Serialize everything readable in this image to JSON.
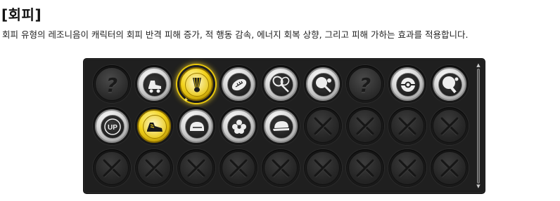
{
  "header": {
    "title": "[회피]",
    "description": "회피 유형의 레조니음이 캐릭터의 회피 반격 피해 증가, 적 행동 감속, 에너지 회복 상향, 그리고 피해 가하는 효과를 적용합니다."
  },
  "locked_glyph": "?",
  "up_badge": "UP",
  "rows": [
    [
      {
        "state": "locked",
        "icon": "question-mark-icon"
      },
      {
        "state": "silver",
        "icon": "roller-skate-icon"
      },
      {
        "state": "gold",
        "icon": "shuttlecock-icon",
        "selected": true
      },
      {
        "state": "silver",
        "icon": "american-football-icon"
      },
      {
        "state": "silver",
        "icon": "badminton-racket-icon"
      },
      {
        "state": "silver",
        "icon": "table-tennis-racket-icon"
      },
      {
        "state": "locked",
        "icon": "question-mark-icon"
      },
      {
        "state": "silver",
        "icon": "pokeball-icon"
      },
      {
        "state": "silver",
        "icon": "ping-pong-paddle-icon"
      }
    ],
    [
      {
        "state": "silver",
        "icon": "up-badge-icon"
      },
      {
        "state": "gold",
        "icon": "sneaker-icon"
      },
      {
        "state": "silver",
        "icon": "helmet-icon"
      },
      {
        "state": "silver",
        "icon": "flower-icon"
      },
      {
        "state": "silver",
        "icon": "cap-icon"
      },
      {
        "state": "empty",
        "icon": "empty-slot-x-icon"
      },
      {
        "state": "empty",
        "icon": "empty-slot-x-icon"
      },
      {
        "state": "empty",
        "icon": "empty-slot-x-icon"
      },
      {
        "state": "empty",
        "icon": "empty-slot-x-icon"
      }
    ],
    [
      {
        "state": "empty",
        "icon": "empty-slot-x-icon"
      },
      {
        "state": "empty",
        "icon": "empty-slot-x-icon"
      },
      {
        "state": "empty",
        "icon": "empty-slot-x-icon"
      },
      {
        "state": "empty",
        "icon": "empty-slot-x-icon"
      },
      {
        "state": "empty",
        "icon": "empty-slot-x-icon"
      },
      {
        "state": "empty",
        "icon": "empty-slot-x-icon"
      },
      {
        "state": "empty",
        "icon": "empty-slot-x-icon"
      },
      {
        "state": "empty",
        "icon": "empty-slot-x-icon"
      },
      {
        "state": "empty",
        "icon": "empty-slot-x-icon"
      }
    ]
  ],
  "colors": {
    "panel_bg": "#1f1f1f",
    "gold": "#f2d21a",
    "silver": "#d9d9d9",
    "selected_glow": "#e8c70c"
  }
}
